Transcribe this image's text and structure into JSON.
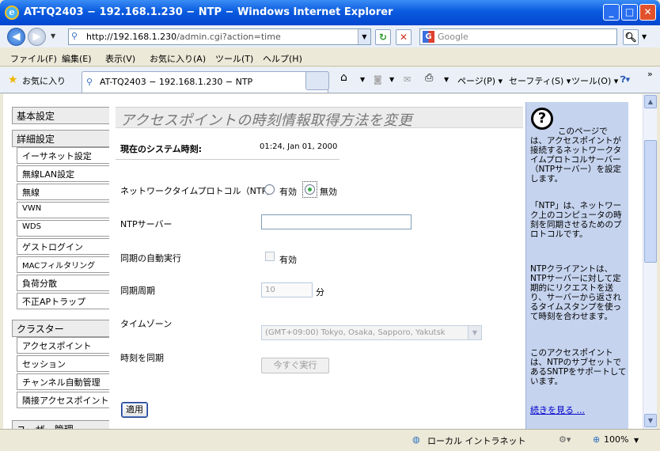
{
  "window": {
    "title": "AT-TQ2403 − 192.168.1.230 − NTP − Windows Internet Explorer"
  },
  "nav": {
    "url_host": "http://192.168.1.230",
    "url_path": "/admin.cgi?action=time",
    "search_placeholder": "Google"
  },
  "menubar": [
    "ファイル(F)",
    "編集(E)",
    "表示(V)",
    "お気に入り(A)",
    "ツール(T)",
    "ヘルプ(H)"
  ],
  "favbar": {
    "favorites": "お気に入り",
    "tab_title": "AT-TQ2403 − 192.168.1.230 − NTP",
    "page": "ページ(P)",
    "safety": "セーフティ(S)",
    "tools": "ツール(O)"
  },
  "sidebar": {
    "basic": "基本設定",
    "detail": "詳細設定",
    "detail_items": [
      "イーサネット設定",
      "無線LAN設定",
      "無線",
      "VWN",
      "WDS",
      "ゲストログイン",
      "MACフィルタリング",
      "負荷分散",
      "不正APトラップ"
    ],
    "cluster": "クラスター",
    "cluster_items": [
      "アクセスポイント",
      "セッション",
      "チャンネル自動管理",
      "隣接アクセスポイント"
    ],
    "user_mgmt": "ユーザー管理"
  },
  "main": {
    "heading": "アクセスポイントの時刻情報取得方法を変更",
    "systime_label": "現在のシステム時刻:",
    "systime_value": "01:24, Jan 01, 2000",
    "ntp_label": "ネットワークタイムプロトコル（NTP）",
    "ntp_on": "有効",
    "ntp_off": "無効",
    "ntp_enabled": false,
    "server_label": "NTPサーバー",
    "server_value": "",
    "autosync_label": "同期の自動実行",
    "autosync_option": "有効",
    "autosync_checked": false,
    "period_label": "同期周期",
    "period_value": "10",
    "period_unit": "分",
    "tz_label": "タイムゾーン",
    "tz_value": "(GMT+09:00) Tokyo, Osaka, Sapporo, Yakutsk",
    "sync_label": "時刻を同期",
    "sync_button": "今すぐ実行",
    "apply_button": "適用"
  },
  "help": {
    "q_icon": "question-icon",
    "para1_first": "このページで",
    "para1_rest": "は、アクセスポイントが接続するネットワークタイムプロトコルサーバー（NTPサーバー）を設定します。",
    "para2": "「NTP」は、ネットワーク上のコンピュータの時刻を同期させるためのプロトコルです。",
    "para3": "NTPクライアントは、NTPサーバーに対して定期的にリクエストを送り、サーバーから返されるタイムスタンプを使って時刻を合わせます。",
    "para4": "このアクセスポイントは、NTPのサブセットであるSNTPをサポートしています。",
    "more_link": "続きを見る ..."
  },
  "status": {
    "zone": "ローカル イントラネット",
    "zoom": "100%"
  },
  "colors": {
    "title_blue": "#0a5bdf",
    "help_bg": "#c5d3ee",
    "link": "#0000cc"
  }
}
